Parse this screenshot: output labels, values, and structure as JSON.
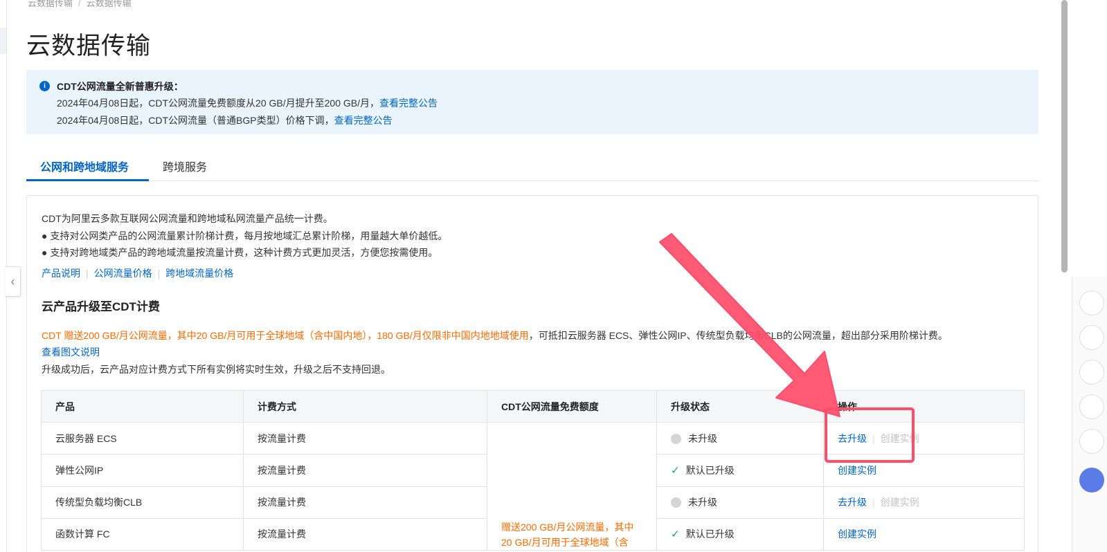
{
  "breadcrumb": {
    "items": [
      "云数据传输",
      "云数据传输"
    ]
  },
  "page": {
    "title": "云数据传输"
  },
  "notice": {
    "icon": "info-icon",
    "title": "CDT公网流量全新普惠升级：",
    "line1_text": "2024年04月08日起，CDT公网流量免费额度从20 GB/月提升至200 GB/月，",
    "line1_link": "查看完整公告",
    "line2_text": "2024年04月08日起，CDT公网流量（普通BGP类型）价格下调，",
    "line2_link": "查看完整公告"
  },
  "tabs": [
    "公网和跨地域服务",
    "跨境服务"
  ],
  "intro": {
    "line1": "CDT为阿里云多款互联网公网流量和跨地域私网流量产品统一计费。",
    "line2": "● 支持对公网类产品的公网流量累计阶梯计费，每月按地域汇总累计阶梯，用量越大单价越低。",
    "line3": "● 支持对跨地域类产品的跨地域流量按流量计费，这种计费方式更加灵活，方便您按需使用。",
    "links": [
      "产品说明",
      "公网流量价格",
      "跨地域流量价格"
    ]
  },
  "section": {
    "title": "云产品升级至CDT计费",
    "promo_orange": "CDT 赠送200 GB/月公网流量，其中20 GB/月可用于全球地域（含中国内地），180 GB/月仅限非中国内地地域使用",
    "promo_rest": "，可抵扣云服务器 ECS、弹性公网IP、传统型负载均衡CLB的公网流量，超出部分采用阶梯计费。",
    "promo_link": "查看图文说明",
    "note": "升级成功后，云产品对应计费方式下所有实例将实时生效，升级之后不支持回退。"
  },
  "table": {
    "headers": [
      "产品",
      "计费方式",
      "CDT公网流量免费额度",
      "升级状态",
      "操作"
    ],
    "quota_text_line1": "赠送200 GB/月公网流量，其中",
    "quota_text_line2": "20 GB/月可用于全球地域（含",
    "rows": [
      {
        "product": "云服务器 ECS",
        "billing": "按流量计费",
        "status": "未升级",
        "status_icon": "gray-dot-icon",
        "action": "去升级",
        "secondary": "创建实例"
      },
      {
        "product": "弹性公网IP",
        "billing": "按流量计费",
        "status": "默认已升级",
        "status_icon": "check-icon",
        "action": "创建实例",
        "secondary": ""
      },
      {
        "product": "传统型负载均衡CLB",
        "billing": "按流量计费",
        "status": "未升级",
        "status_icon": "gray-dot-icon",
        "action": "去升级",
        "secondary": "创建实例"
      },
      {
        "product": "函数计算 FC",
        "billing": "按流量计费",
        "status": "默认已升级",
        "status_icon": "check-icon",
        "action": "创建实例",
        "secondary": ""
      }
    ]
  },
  "colors": {
    "primary": "#0064c8",
    "orange": "#ff6a00",
    "notice_bg": "#e9f4fd",
    "annotation": "#ff4d6a",
    "success": "#22a06b"
  },
  "annotation": {
    "arrow_icon": "red-arrow-annotation",
    "box": "red-highlight-box"
  }
}
